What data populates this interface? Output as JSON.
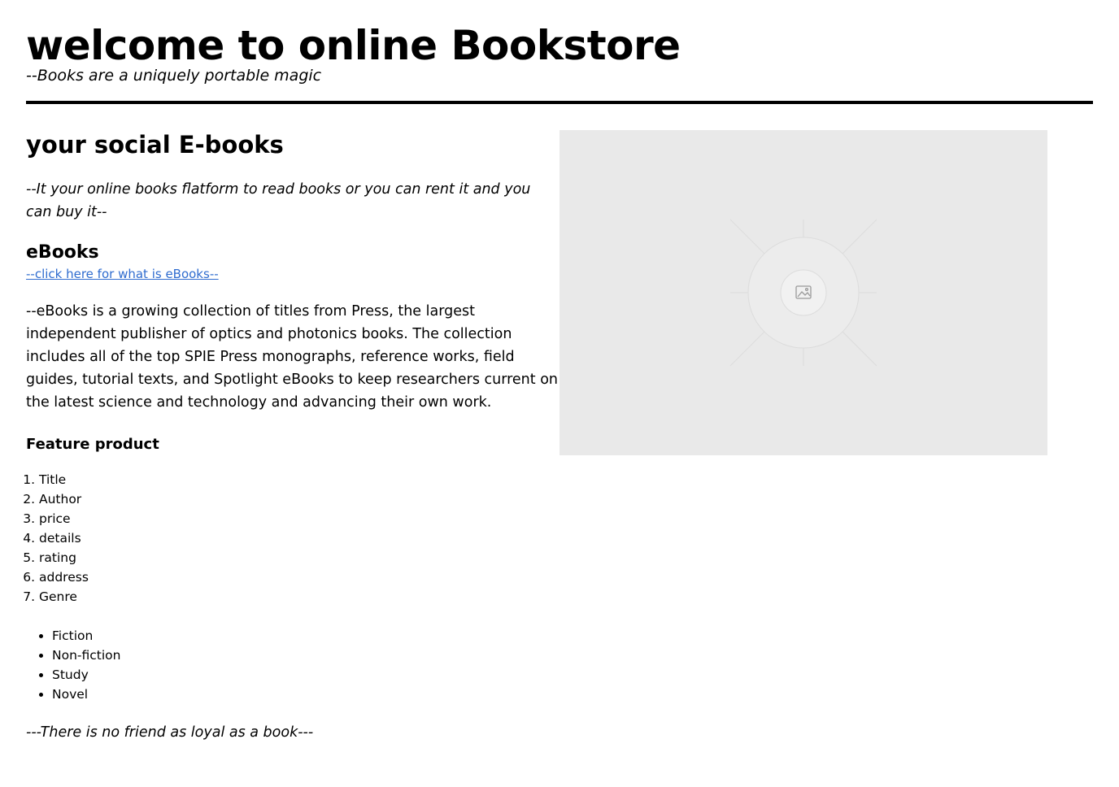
{
  "header": {
    "title": "welcome to online Bookstore",
    "tagline": "--Books are a uniquely portable magic"
  },
  "main": {
    "heading": "your social E-books",
    "intro": "--It your online books flatform to read books or you can rent it and you can buy it--",
    "ebooks_heading": "eBooks",
    "ebooks_link": "--click here for what is eBooks--",
    "description": "--eBooks is a growing collection of titles from Press, the largest independent publisher of optics and photonics books. The collection includes all of the top SPIE Press monographs, reference works, field guides, tutorial texts, and Spotlight eBooks to keep researchers current on the latest science and technology and advancing their own work.",
    "feature_heading": "Feature product",
    "features": [
      "Title",
      "Author",
      "price",
      "details",
      "rating",
      "address",
      "Genre"
    ],
    "genres": [
      "Fiction",
      "Non-fiction",
      "Study",
      "Novel"
    ],
    "quote": "---There is no friend as loyal as a book---"
  },
  "image": {
    "icon": "image-placeholder-icon"
  },
  "colors": {
    "link": "#2f6ccf",
    "placeholder_bg": "#e9e9e9",
    "rule": "#000000"
  }
}
